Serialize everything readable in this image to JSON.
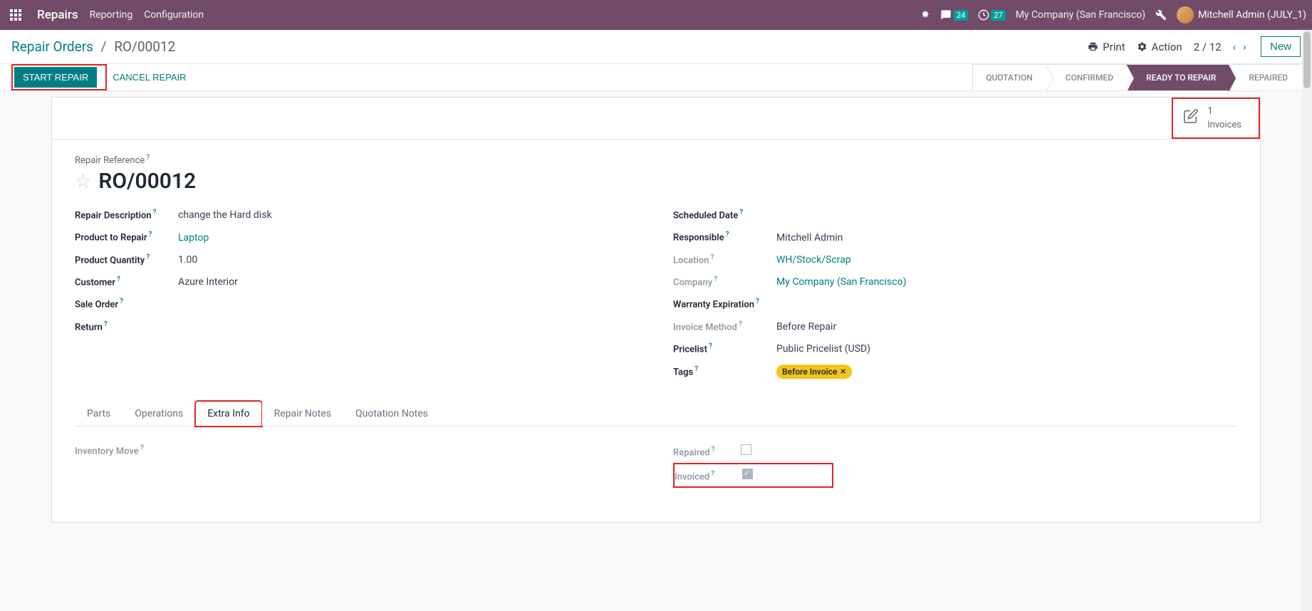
{
  "navbar": {
    "brand": "Repairs",
    "menu": [
      "Reporting",
      "Configuration"
    ],
    "chat_count": "24",
    "clock_count": "27",
    "company": "My Company (San Francisco)",
    "user": "Mitchell Admin (JULY_1)"
  },
  "breadcrumb": {
    "parent": "Repair Orders",
    "current": "RO/00012",
    "print": "Print",
    "action": "Action",
    "pager": "2 / 12",
    "new_btn": "New"
  },
  "statusbar": {
    "start": "START REPAIR",
    "cancel": "CANCEL REPAIR",
    "stages": [
      "QUOTATION",
      "CONFIRMED",
      "READY TO REPAIR",
      "REPAIRED"
    ],
    "active_stage": 2
  },
  "stat_button": {
    "count": "1",
    "label": "Invoices"
  },
  "form": {
    "ref_label": "Repair Reference",
    "ref_value": "RO/00012",
    "left": [
      {
        "label": "Repair Description",
        "value": "change the Hard disk",
        "link": false
      },
      {
        "label": "Product to Repair",
        "value": "Laptop",
        "link": true
      },
      {
        "label": "Product Quantity",
        "value": "1.00",
        "link": false
      },
      {
        "label": "Customer",
        "value": "Azure Interior",
        "link": false
      },
      {
        "label": "Sale Order",
        "value": "",
        "link": false
      },
      {
        "label": "Return",
        "value": "",
        "link": false
      }
    ],
    "right": [
      {
        "label": "Scheduled Date",
        "value": "",
        "link": false,
        "muted": false
      },
      {
        "label": "Responsible",
        "value": "Mitchell Admin",
        "link": false,
        "muted": false
      },
      {
        "label": "Location",
        "value": "WH/Stock/Scrap",
        "link": true,
        "muted": true
      },
      {
        "label": "Company",
        "value": "My Company (San Francisco)",
        "link": true,
        "muted": true
      },
      {
        "label": "Warranty Expiration",
        "value": "",
        "link": false,
        "muted": false
      },
      {
        "label": "Invoice Method",
        "value": "Before Repair",
        "link": false,
        "muted": true
      },
      {
        "label": "Pricelist",
        "value": "Public Pricelist (USD)",
        "link": false,
        "muted": false
      }
    ],
    "tags_label": "Tags",
    "tag_value": "Before Invoice"
  },
  "tabs": [
    "Parts",
    "Operations",
    "Extra Info",
    "Repair Notes",
    "Quotation Notes"
  ],
  "active_tab": 2,
  "extra_info": {
    "inventory_move": "Inventory Move",
    "repaired": "Repaired",
    "invoiced": "Invoiced"
  }
}
